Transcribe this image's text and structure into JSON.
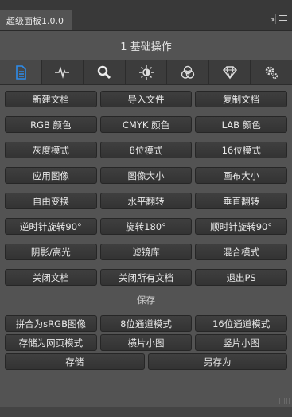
{
  "panel": {
    "tab_title": "超级面板1.0.0",
    "header_title": "1 基础操作"
  },
  "toolbar": {
    "tools": [
      {
        "icon": "document-icon",
        "active": true
      },
      {
        "icon": "waveform-icon",
        "active": false
      },
      {
        "icon": "magnifier-icon",
        "active": false
      },
      {
        "icon": "brightness-icon",
        "active": false
      },
      {
        "icon": "color-circles-icon",
        "active": false
      },
      {
        "icon": "diamond-icon",
        "active": false
      },
      {
        "icon": "gears-icon",
        "active": false
      }
    ]
  },
  "rows": [
    [
      "新建文档",
      "导入文件",
      "复制文档"
    ],
    [
      "RGB 颜色",
      "CMYK 颜色",
      "LAB 颜色"
    ],
    [
      "灰度模式",
      "8位模式",
      "16位模式"
    ],
    [
      "应用图像",
      "图像大小",
      "画布大小"
    ],
    [
      "自由变换",
      "水平翻转",
      "垂直翻转"
    ],
    [
      "逆时针旋转90°",
      "旋转180°",
      "顺时针旋转90°"
    ],
    [
      "阴影/高光",
      "滤镜库",
      "混合模式"
    ],
    [
      "关闭文档",
      "关闭所有文档",
      "退出PS"
    ]
  ],
  "save_section": {
    "label": "保存",
    "rows": [
      [
        "拼合为sRGB图像",
        "8位通道模式",
        "16位通道模式"
      ],
      [
        "存储为网页模式",
        "横片小图",
        "竖片小图"
      ],
      [
        "存储",
        "另存为"
      ]
    ]
  },
  "colors": {
    "panel_bg": "#535353",
    "button_bg": "#383838",
    "toolbar_bg": "#3c3c3c",
    "active_icon": "#2d8ceb"
  }
}
